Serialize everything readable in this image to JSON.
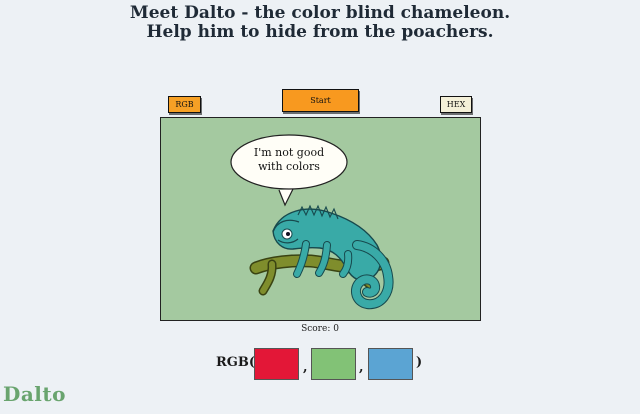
{
  "header": {
    "line1": "Meet Dalto - the color blind chameleon.",
    "line2": "Help him to hide from the poachers."
  },
  "controls": {
    "rgb_label": "RGB",
    "start_label": "Start",
    "hex_label": "HEX"
  },
  "stage": {
    "background_color": "#a4c9a0",
    "speech_text_line1": "I'm not good",
    "speech_text_line2": "with colors",
    "chameleon_color": "#39aaa7",
    "branch_color": "#7f8d2c"
  },
  "score": {
    "label": "Score:",
    "value": "0",
    "display": "Score: 0"
  },
  "color_input": {
    "prefix": "RGB(",
    "separator": ",",
    "suffix": ")",
    "swatches": [
      {
        "name": "red",
        "color": "#e31737"
      },
      {
        "name": "green",
        "color": "#82c276"
      },
      {
        "name": "blue",
        "color": "#5ba4d3"
      }
    ]
  },
  "footer": {
    "logo": "Dalto"
  }
}
